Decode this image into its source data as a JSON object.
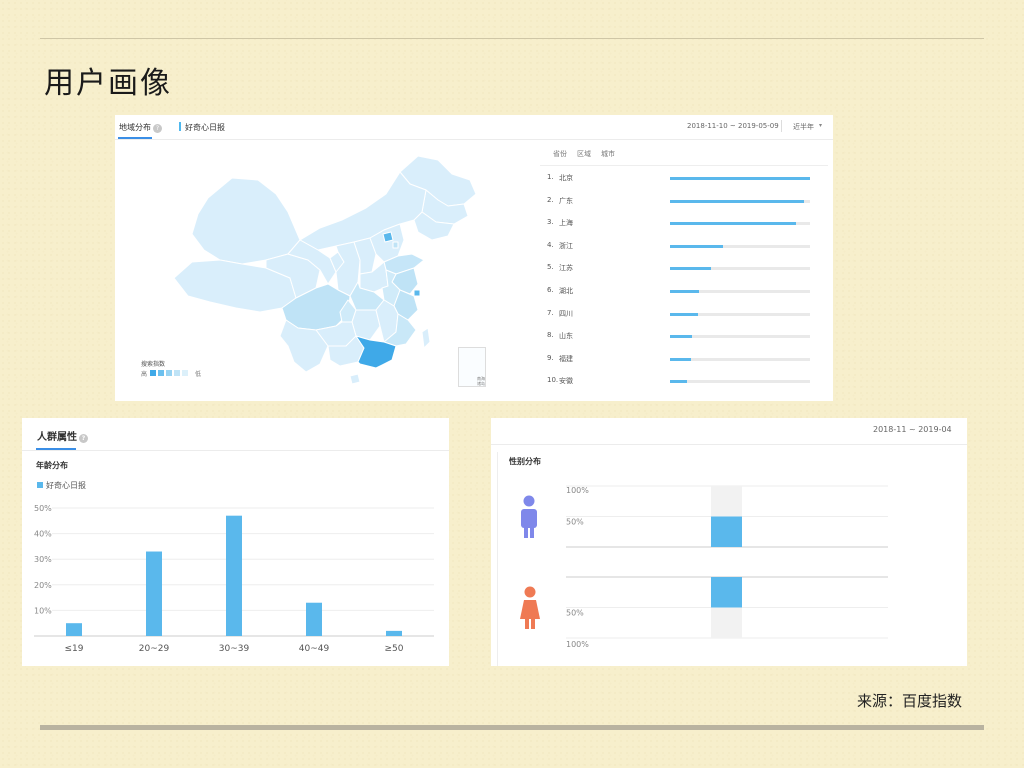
{
  "slide": {
    "title": "用户画像",
    "source": "来源：百度指数"
  },
  "region_card": {
    "tab_active": "地域分布",
    "legend": "好奇心日报",
    "date_range": "2018-11-10 ~ 2019-05-09",
    "range_select": "近半年",
    "map_legend_title": "搜索指数",
    "map_legend_high": "高",
    "map_legend_low": "低",
    "map_legend_colors": [
      "#3fa9e8",
      "#6cc0ee",
      "#98d3f2",
      "#bfe3f6",
      "#dcf0fa"
    ],
    "inset_label": "南海诸岛",
    "rank_tabs": [
      "省份",
      "区域",
      "城市"
    ],
    "colors": {
      "accent": "#5ab8ec",
      "track": "#e9e9e9",
      "land": "#d9eefb",
      "border": "#ffffff"
    }
  },
  "chart_data": [
    {
      "type": "bar",
      "title": "地域分布",
      "categories": [
        "北京",
        "广东",
        "上海",
        "浙江",
        "江苏",
        "湖北",
        "四川",
        "山东",
        "福建",
        "安徽"
      ],
      "ranks": [
        "1.",
        "2.",
        "3.",
        "4.",
        "5.",
        "6.",
        "7.",
        "8.",
        "9.",
        "10."
      ],
      "values": [
        100,
        96,
        90,
        38,
        29,
        21,
        20,
        16,
        15,
        12
      ],
      "orientation": "horizontal",
      "xlim": [
        0,
        100
      ],
      "grid": false
    },
    {
      "type": "bar",
      "title": "人群属性",
      "subtitle": "年龄分布",
      "categories": [
        "≤19",
        "20~29",
        "30~39",
        "40~49",
        "≥50"
      ],
      "series": [
        {
          "name": "好奇心日报",
          "values": [
            5,
            33,
            47,
            13,
            2
          ]
        }
      ],
      "ylim": [
        0,
        50
      ],
      "yticks": [
        "10%",
        "20%",
        "30%",
        "40%",
        "50%"
      ],
      "grid": true,
      "legend": "top-left",
      "color": "#5ab8ec"
    },
    {
      "type": "bar",
      "title": "性别分布",
      "date_range": "2018-11 ~ 2019-04",
      "categories": [
        "男",
        "女"
      ],
      "values": [
        50,
        50
      ],
      "yticks_top": [
        "100%",
        "50%"
      ],
      "yticks_bottom": [
        "50%",
        "100%"
      ],
      "colors": {
        "bar": "#5ab8ec",
        "track": "#f2f2f2",
        "male": "#7f88ea",
        "female": "#ef7a54"
      }
    }
  ]
}
